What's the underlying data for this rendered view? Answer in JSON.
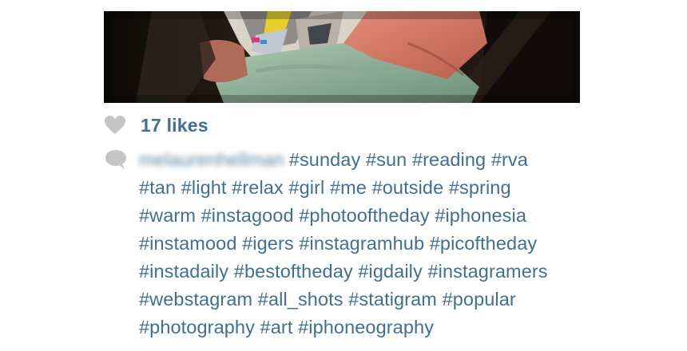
{
  "post": {
    "likes_text": "17 likes",
    "username": "melaurenhellman",
    "hashtags": [
      "#sunday #sun #reading #rva",
      "#tan #light #relax #girl #me #outside #spring",
      "#warm #instagood #photooftheday #iphonesia",
      "#instamood #igers #instagramhub #picoftheday",
      "#instadaily #bestoftheday #igdaily #instagramers",
      "#webstagram #all_shots #statigram #popular",
      "#photography #art #iphoneography"
    ]
  },
  "icons": {
    "like": "heart-icon",
    "comment": "comment-bubble-icon"
  },
  "colors": {
    "link_blue": "#3f6f93",
    "icon_gray": "#c4c4c4",
    "background": "#ffffff"
  }
}
